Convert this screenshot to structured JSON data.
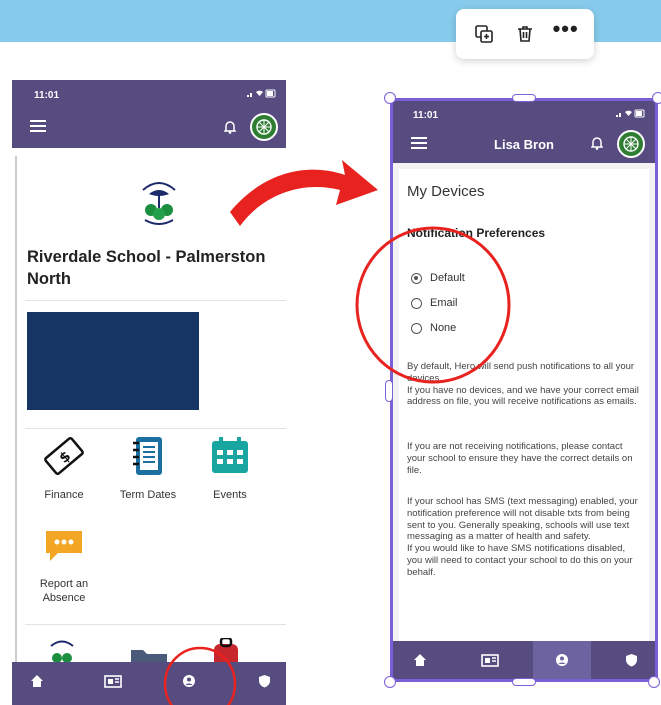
{
  "toolbar": {
    "icons": [
      "duplicate-icon",
      "delete-icon",
      "more-icon"
    ],
    "more_label": "•••"
  },
  "left_phone": {
    "status_time": "11:01",
    "school_name": "Riverdale School - Palmerston North",
    "tiles": [
      {
        "label": "Finance",
        "icon": "money-icon"
      },
      {
        "label": "Term Dates",
        "icon": "notebook-icon"
      },
      {
        "label": "Events",
        "icon": "calendar-icon"
      },
      {
        "label": "Report an Absence",
        "icon": "chat-bubble-icon"
      }
    ],
    "nav_icons": [
      "home-icon",
      "newspaper-icon",
      "profile-icon",
      "shield-icon"
    ]
  },
  "right_phone": {
    "status_time": "11:01",
    "user_name": "Lisa Bron",
    "page_title": "My Devices",
    "section_title": "Notification Preferences",
    "options": [
      {
        "label": "Default",
        "selected": true
      },
      {
        "label": "Email",
        "selected": false
      },
      {
        "label": "None",
        "selected": false
      }
    ],
    "paragraphs": [
      "By default, Hero will send push notifications to all your devices.\nIf you have no devices, and we have your correct email address on file, you will receive notifications as emails.",
      "If you are not receiving notifications, please contact your school to ensure they have the correct details on file.",
      "If your school has SMS (text messaging) enabled, your notification preference will not disable txts from being sent to you. Generally speaking, schools will use text messaging as a matter of health and safety.\nIf you would like to have SMS notifications disabled, you will need to contact your school to do this on your behalf."
    ]
  },
  "colors": {
    "app_purple": "#574c7f",
    "banner_navy": "#163464",
    "annotation_red": "#e8231f",
    "selection_purple": "#7b5fd6",
    "sky_band": "#87cbec"
  }
}
